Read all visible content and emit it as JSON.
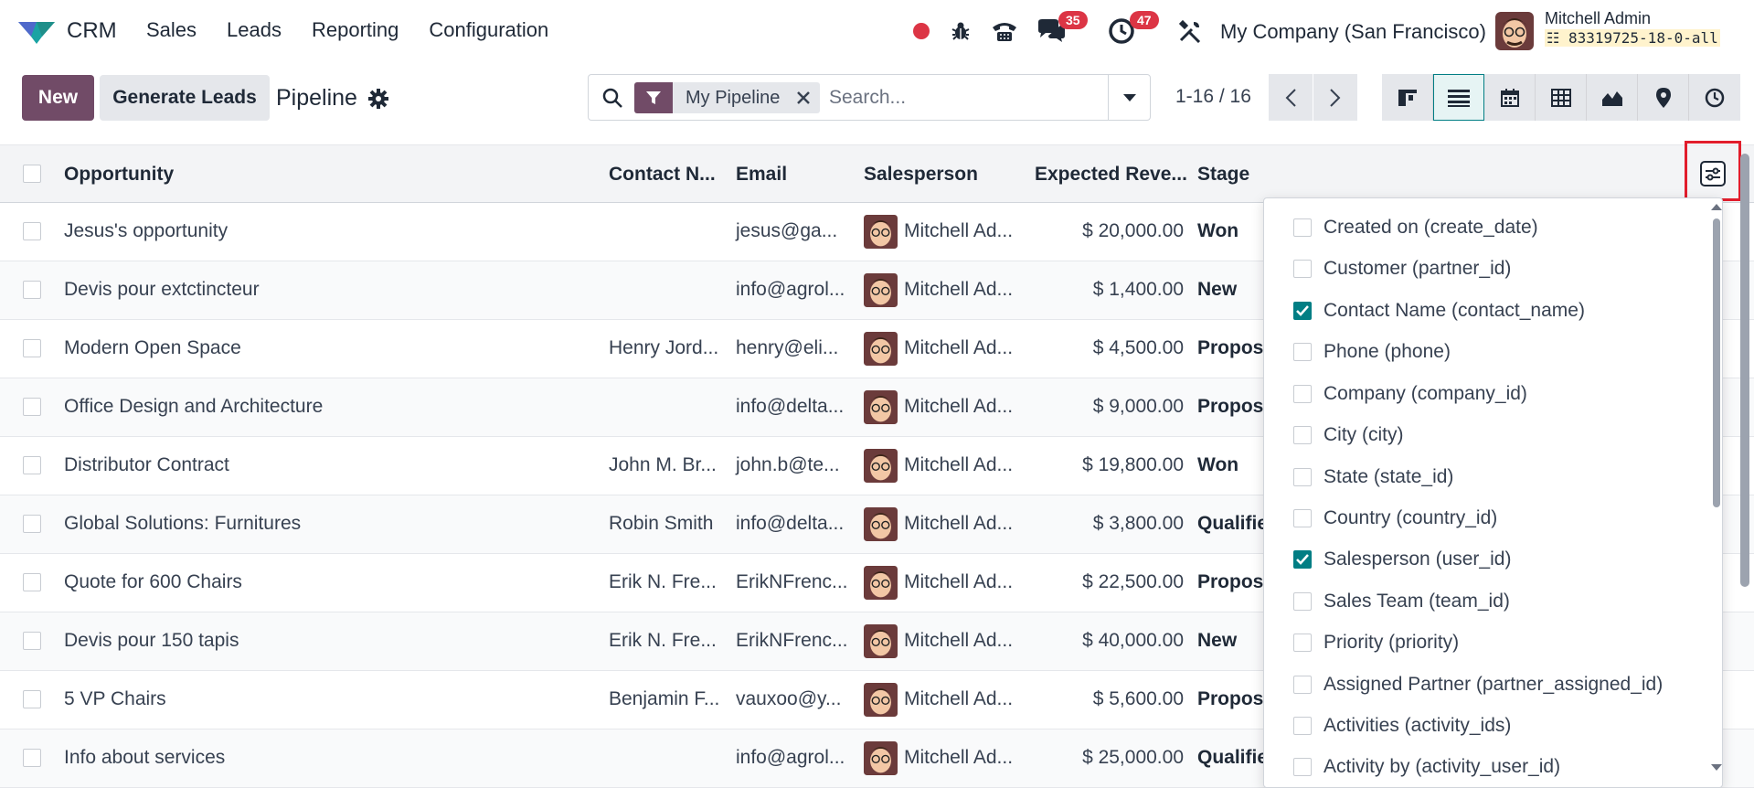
{
  "app": {
    "name": "CRM"
  },
  "menu": [
    "Sales",
    "Leads",
    "Reporting",
    "Configuration"
  ],
  "systray": {
    "messages_count": "35",
    "activities_count": "47",
    "company": "My Company (San Francisco)",
    "user_name": "Mitchell Admin",
    "db": "83319725-18-0-all"
  },
  "control": {
    "new_label": "New",
    "generate_label": "Generate Leads",
    "title": "Pipeline",
    "facet": "My Pipeline",
    "search_placeholder": "Search...",
    "pager": "1-16 / 16"
  },
  "columns": {
    "opportunity": "Opportunity",
    "contact": "Contact N...",
    "email": "Email",
    "salesperson": "Salesperson",
    "revenue": "Expected Reve...",
    "stage": "Stage"
  },
  "rows": [
    {
      "opportunity": "Jesus's opportunity",
      "contact": "",
      "email": "jesus@ga...",
      "salesperson": "Mitchell Ad...",
      "revenue": "$ 20,000.00",
      "stage": "Won"
    },
    {
      "opportunity": "Devis pour extctincteur",
      "contact": "",
      "email": "info@agrol...",
      "salesperson": "Mitchell Ad...",
      "revenue": "$ 1,400.00",
      "stage": "New"
    },
    {
      "opportunity": "Modern Open Space",
      "contact": "Henry Jord...",
      "email": "henry@eli...",
      "salesperson": "Mitchell Ad...",
      "revenue": "$ 4,500.00",
      "stage": "Propos"
    },
    {
      "opportunity": "Office Design and Architecture",
      "contact": "",
      "email": "info@delta...",
      "salesperson": "Mitchell Ad...",
      "revenue": "$ 9,000.00",
      "stage": "Propos"
    },
    {
      "opportunity": "Distributor Contract",
      "contact": "John M. Br...",
      "email": "john.b@te...",
      "salesperson": "Mitchell Ad...",
      "revenue": "$ 19,800.00",
      "stage": "Won"
    },
    {
      "opportunity": "Global Solutions: Furnitures",
      "contact": "Robin Smith",
      "email": "info@delta...",
      "salesperson": "Mitchell Ad...",
      "revenue": "$ 3,800.00",
      "stage": "Qualifie"
    },
    {
      "opportunity": "Quote for 600 Chairs",
      "contact": "Erik N. Fre...",
      "email": "ErikNFrenc...",
      "salesperson": "Mitchell Ad...",
      "revenue": "$ 22,500.00",
      "stage": "Propos"
    },
    {
      "opportunity": "Devis pour 150 tapis",
      "contact": "Erik N. Fre...",
      "email": "ErikNFrenc...",
      "salesperson": "Mitchell Ad...",
      "revenue": "$ 40,000.00",
      "stage": "New"
    },
    {
      "opportunity": "5 VP Chairs",
      "contact": "Benjamin F...",
      "email": "vauxoo@y...",
      "salesperson": "Mitchell Ad...",
      "revenue": "$ 5,600.00",
      "stage": "Propos"
    },
    {
      "opportunity": "Info about services",
      "contact": "",
      "email": "info@agrol...",
      "salesperson": "Mitchell Ad...",
      "revenue": "$ 25,000.00",
      "stage": "Qualifie"
    }
  ],
  "optional_columns": [
    {
      "label": "Created on (create_date)",
      "checked": false
    },
    {
      "label": "Customer (partner_id)",
      "checked": false
    },
    {
      "label": "Contact Name (contact_name)",
      "checked": true
    },
    {
      "label": "Phone (phone)",
      "checked": false
    },
    {
      "label": "Company (company_id)",
      "checked": false
    },
    {
      "label": "City (city)",
      "checked": false
    },
    {
      "label": "State (state_id)",
      "checked": false
    },
    {
      "label": "Country (country_id)",
      "checked": false
    },
    {
      "label": "Salesperson (user_id)",
      "checked": true
    },
    {
      "label": "Sales Team (team_id)",
      "checked": false
    },
    {
      "label": "Priority (priority)",
      "checked": false
    },
    {
      "label": "Assigned Partner (partner_assigned_id)",
      "checked": false
    },
    {
      "label": "Activities (activity_ids)",
      "checked": false
    },
    {
      "label": "Activity by (activity_user_id)",
      "checked": false
    }
  ],
  "colors": {
    "primary": "#714b67",
    "accent": "#017e84",
    "badge": "#dc3545",
    "highlight": "#e11d2c"
  }
}
